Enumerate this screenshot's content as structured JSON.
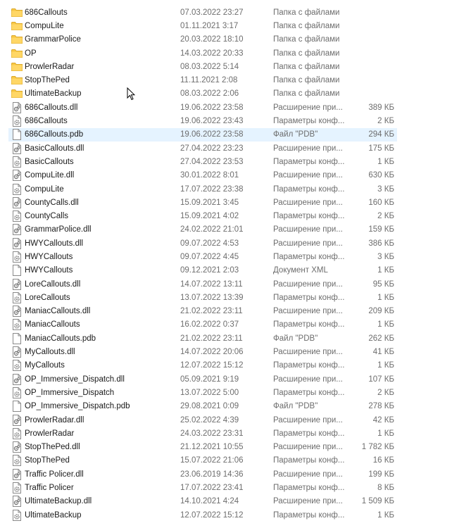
{
  "files": [
    {
      "name": "686Callouts",
      "date": "07.03.2022 23:27",
      "type": "Папка с файлами",
      "size": "",
      "icon": "folder-icon"
    },
    {
      "name": "CompuLite",
      "date": "01.11.2021 3:17",
      "type": "Папка с файлами",
      "size": "",
      "icon": "folder-icon"
    },
    {
      "name": "GrammarPolice",
      "date": "20.03.2022 18:10",
      "type": "Папка с файлами",
      "size": "",
      "icon": "folder-icon"
    },
    {
      "name": "OP",
      "date": "14.03.2022 20:33",
      "type": "Папка с файлами",
      "size": "",
      "icon": "folder-icon"
    },
    {
      "name": "ProwlerRadar",
      "date": "08.03.2022 5:14",
      "type": "Папка с файлами",
      "size": "",
      "icon": "folder-icon"
    },
    {
      "name": "StopThePed",
      "date": "11.11.2021 2:08",
      "type": "Папка с файлами",
      "size": "",
      "icon": "folder-icon"
    },
    {
      "name": "UltimateBackup",
      "date": "08.03.2022 2:06",
      "type": "Папка с файлами",
      "size": "",
      "icon": "folder-icon"
    },
    {
      "name": "686Callouts.dll",
      "date": "19.06.2022 23:58",
      "type": "Расширение при...",
      "size": "389 КБ",
      "icon": "dll-file-icon"
    },
    {
      "name": "686Callouts",
      "date": "19.06.2022 23:43",
      "type": "Параметры конф...",
      "size": "2 КБ",
      "icon": "config-file-icon"
    },
    {
      "name": "686Callouts.pdb",
      "date": "19.06.2022 23:58",
      "type": "Файл \"PDB\"",
      "size": "294 КБ",
      "icon": "blank-file-icon"
    },
    {
      "name": "BasicCallouts.dll",
      "date": "27.04.2022 23:23",
      "type": "Расширение при...",
      "size": "175 КБ",
      "icon": "dll-file-icon"
    },
    {
      "name": "BasicCallouts",
      "date": "27.04.2022 23:53",
      "type": "Параметры конф...",
      "size": "1 КБ",
      "icon": "config-file-icon"
    },
    {
      "name": "CompuLite.dll",
      "date": "30.01.2022 8:01",
      "type": "Расширение при...",
      "size": "630 КБ",
      "icon": "dll-file-icon"
    },
    {
      "name": "CompuLite",
      "date": "17.07.2022 23:38",
      "type": "Параметры конф...",
      "size": "3 КБ",
      "icon": "config-file-icon"
    },
    {
      "name": "CountyCalls.dll",
      "date": "15.09.2021 3:45",
      "type": "Расширение при...",
      "size": "160 КБ",
      "icon": "dll-file-icon"
    },
    {
      "name": "CountyCalls",
      "date": "15.09.2021 4:02",
      "type": "Параметры конф...",
      "size": "2 КБ",
      "icon": "config-file-icon"
    },
    {
      "name": "GrammarPolice.dll",
      "date": "24.02.2022 21:01",
      "type": "Расширение при...",
      "size": "159 КБ",
      "icon": "dll-file-icon"
    },
    {
      "name": "HWYCallouts.dll",
      "date": "09.07.2022 4:53",
      "type": "Расширение при...",
      "size": "386 КБ",
      "icon": "dll-file-icon"
    },
    {
      "name": "HWYCallouts",
      "date": "09.07.2022 4:45",
      "type": "Параметры конф...",
      "size": "3 КБ",
      "icon": "config-file-icon"
    },
    {
      "name": "HWYCallouts",
      "date": "09.12.2021 2:03",
      "type": "Документ XML",
      "size": "1 КБ",
      "icon": "blank-file-icon"
    },
    {
      "name": "LoreCallouts.dll",
      "date": "14.07.2022 13:11",
      "type": "Расширение при...",
      "size": "95 КБ",
      "icon": "dll-file-icon"
    },
    {
      "name": "LoreCallouts",
      "date": "13.07.2022 13:39",
      "type": "Параметры конф...",
      "size": "1 КБ",
      "icon": "config-file-icon"
    },
    {
      "name": "ManiacCallouts.dll",
      "date": "21.02.2022 23:11",
      "type": "Расширение при...",
      "size": "209 КБ",
      "icon": "dll-file-icon"
    },
    {
      "name": "ManiacCallouts",
      "date": "16.02.2022 0:37",
      "type": "Параметры конф...",
      "size": "1 КБ",
      "icon": "config-file-icon"
    },
    {
      "name": "ManiacCallouts.pdb",
      "date": "21.02.2022 23:11",
      "type": "Файл \"PDB\"",
      "size": "262 КБ",
      "icon": "blank-file-icon"
    },
    {
      "name": "MyCallouts.dll",
      "date": "14.07.2022 20:06",
      "type": "Расширение при...",
      "size": "41 КБ",
      "icon": "dll-file-icon"
    },
    {
      "name": "MyCallouts",
      "date": "12.07.2022 15:12",
      "type": "Параметры конф...",
      "size": "1 КБ",
      "icon": "config-file-icon"
    },
    {
      "name": "OP_Immersive_Dispatch.dll",
      "date": "05.09.2021 9:19",
      "type": "Расширение при...",
      "size": "107 КБ",
      "icon": "dll-file-icon"
    },
    {
      "name": "OP_Immersive_Dispatch",
      "date": "13.07.2022 5:00",
      "type": "Параметры конф...",
      "size": "2 КБ",
      "icon": "config-file-icon"
    },
    {
      "name": "OP_Immersive_Dispatch.pdb",
      "date": "29.08.2021 0:09",
      "type": "Файл \"PDB\"",
      "size": "278 КБ",
      "icon": "blank-file-icon"
    },
    {
      "name": "ProwlerRadar.dll",
      "date": "25.02.2022 4:39",
      "type": "Расширение при...",
      "size": "42 КБ",
      "icon": "dll-file-icon"
    },
    {
      "name": "ProwlerRadar",
      "date": "24.03.2022 23:31",
      "type": "Параметры конф...",
      "size": "1 КБ",
      "icon": "config-file-icon"
    },
    {
      "name": "StopThePed.dll",
      "date": "21.12.2021 10:55",
      "type": "Расширение при...",
      "size": "1 782 КБ",
      "icon": "dll-file-icon"
    },
    {
      "name": "StopThePed",
      "date": "15.07.2022 21:06",
      "type": "Параметры конф...",
      "size": "16 КБ",
      "icon": "config-file-icon"
    },
    {
      "name": "Traffic Policer.dll",
      "date": "23.06.2019 14:36",
      "type": "Расширение при...",
      "size": "199 КБ",
      "icon": "dll-file-icon"
    },
    {
      "name": "Traffic Policer",
      "date": "17.07.2022 23:41",
      "type": "Параметры конф...",
      "size": "8 КБ",
      "icon": "config-file-icon"
    },
    {
      "name": "UltimateBackup.dll",
      "date": "14.10.2021 4:24",
      "type": "Расширение при...",
      "size": "1 509 КБ",
      "icon": "dll-file-icon"
    },
    {
      "name": "UltimateBackup",
      "date": "12.07.2022 15:12",
      "type": "Параметры конф...",
      "size": "1 КБ",
      "icon": "config-file-icon"
    }
  ],
  "selected_index": 9,
  "colors": {
    "folder": "#f8c845",
    "selection": "#e5f3ff"
  }
}
